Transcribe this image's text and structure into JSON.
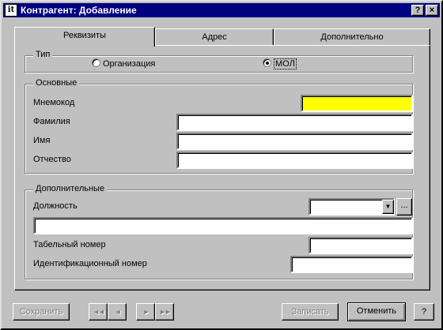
{
  "window": {
    "title": "Контрагент: Добавление",
    "icon_label": "it",
    "help_button": "?",
    "close_button": "×"
  },
  "tabs": [
    {
      "label": "Реквизиты",
      "active": true
    },
    {
      "label": "Адрес",
      "active": false
    },
    {
      "label": "Дополнительно",
      "active": false
    }
  ],
  "type_group": {
    "legend": "Тип",
    "options": [
      {
        "label": "Организация",
        "checked": false
      },
      {
        "label": "МОЛ",
        "checked": true
      }
    ]
  },
  "main_group": {
    "legend": "Основные",
    "mnemocode_label": "Мнемокод",
    "surname_label": "Фамилия",
    "name_label": "Имя",
    "patronymic_label": "Отчество",
    "mnemocode_value": "",
    "surname_value": "",
    "name_value": "",
    "patronymic_value": ""
  },
  "extra_group": {
    "legend": "Дополнительные",
    "position_label": "Должность",
    "position_value": "",
    "position_text_value": "",
    "dots_label": "...",
    "dropdown_glyph": "▼",
    "tabnum_label": "Табельный номер",
    "tabnum_value": "",
    "idnum_label": "Идентификационный номер",
    "idnum_value": ""
  },
  "footer": {
    "save_label": "Сохранить",
    "nav_first": "◄◄",
    "nav_prev": "◄",
    "nav_next": "►",
    "nav_last": "►►",
    "write_label": "Записать",
    "cancel_label": "Отменить",
    "help_label": "?"
  },
  "colors": {
    "titlebar": "#000080",
    "face": "#c0c0c0",
    "required_field": "#ffff00"
  }
}
